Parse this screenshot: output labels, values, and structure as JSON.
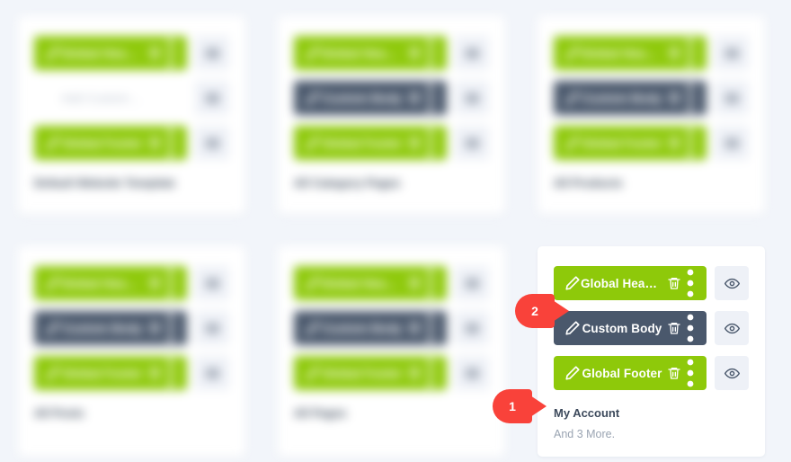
{
  "theme": {
    "page_background": "#f2f5fa",
    "card_background": "#ffffff",
    "green": "#8ec90a",
    "slate": "#4a586c",
    "eye_button_background": "#eef1f7",
    "callout_red": "#f9423a",
    "title_color": "#3d4a5c",
    "muted_color": "#9aa4b2"
  },
  "icons": {
    "pencil": "pencil-icon",
    "trash": "trash-icon",
    "dots": "more-options-icon",
    "eye": "eye-icon"
  },
  "callouts": [
    {
      "number": "1",
      "target": "my-account-template-title"
    },
    {
      "number": "2",
      "target": "custom-body-template-row"
    }
  ],
  "cards": [
    {
      "id": "card-1",
      "blurred": true,
      "rows": [
        {
          "style": "green",
          "label": "Global Header"
        },
        {
          "style": "plain",
          "label": "Add Custom Body"
        },
        {
          "style": "green",
          "label": "Global Footer"
        }
      ],
      "title": "Default Website Template",
      "subtitle": ""
    },
    {
      "id": "card-2",
      "blurred": true,
      "rows": [
        {
          "style": "green",
          "label": "Global Header"
        },
        {
          "style": "slate",
          "label": "Custom Body"
        },
        {
          "style": "green",
          "label": "Global Footer"
        }
      ],
      "title": "All Category Pages",
      "subtitle": ""
    },
    {
      "id": "card-3",
      "blurred": true,
      "rows": [
        {
          "style": "green",
          "label": "Global Header"
        },
        {
          "style": "slate",
          "label": "Custom Body"
        },
        {
          "style": "green",
          "label": "Global Footer"
        }
      ],
      "title": "All Products",
      "subtitle": ""
    },
    {
      "id": "card-4",
      "blurred": true,
      "rows": [
        {
          "style": "green",
          "label": "Global Header"
        },
        {
          "style": "slate",
          "label": "Custom Body"
        },
        {
          "style": "green",
          "label": "Global Footer"
        }
      ],
      "title": "All Posts",
      "subtitle": ""
    },
    {
      "id": "card-5",
      "blurred": true,
      "rows": [
        {
          "style": "green",
          "label": "Global Header"
        },
        {
          "style": "slate",
          "label": "Custom Body"
        },
        {
          "style": "green",
          "label": "Global Footer"
        }
      ],
      "title": "All Pages",
      "subtitle": ""
    },
    {
      "id": "card-6",
      "blurred": false,
      "rows": [
        {
          "style": "green",
          "label": "Global Header"
        },
        {
          "style": "slate",
          "label": "Custom Body"
        },
        {
          "style": "green",
          "label": "Global Footer"
        }
      ],
      "title": "My Account",
      "subtitle": "And 3 More."
    }
  ]
}
